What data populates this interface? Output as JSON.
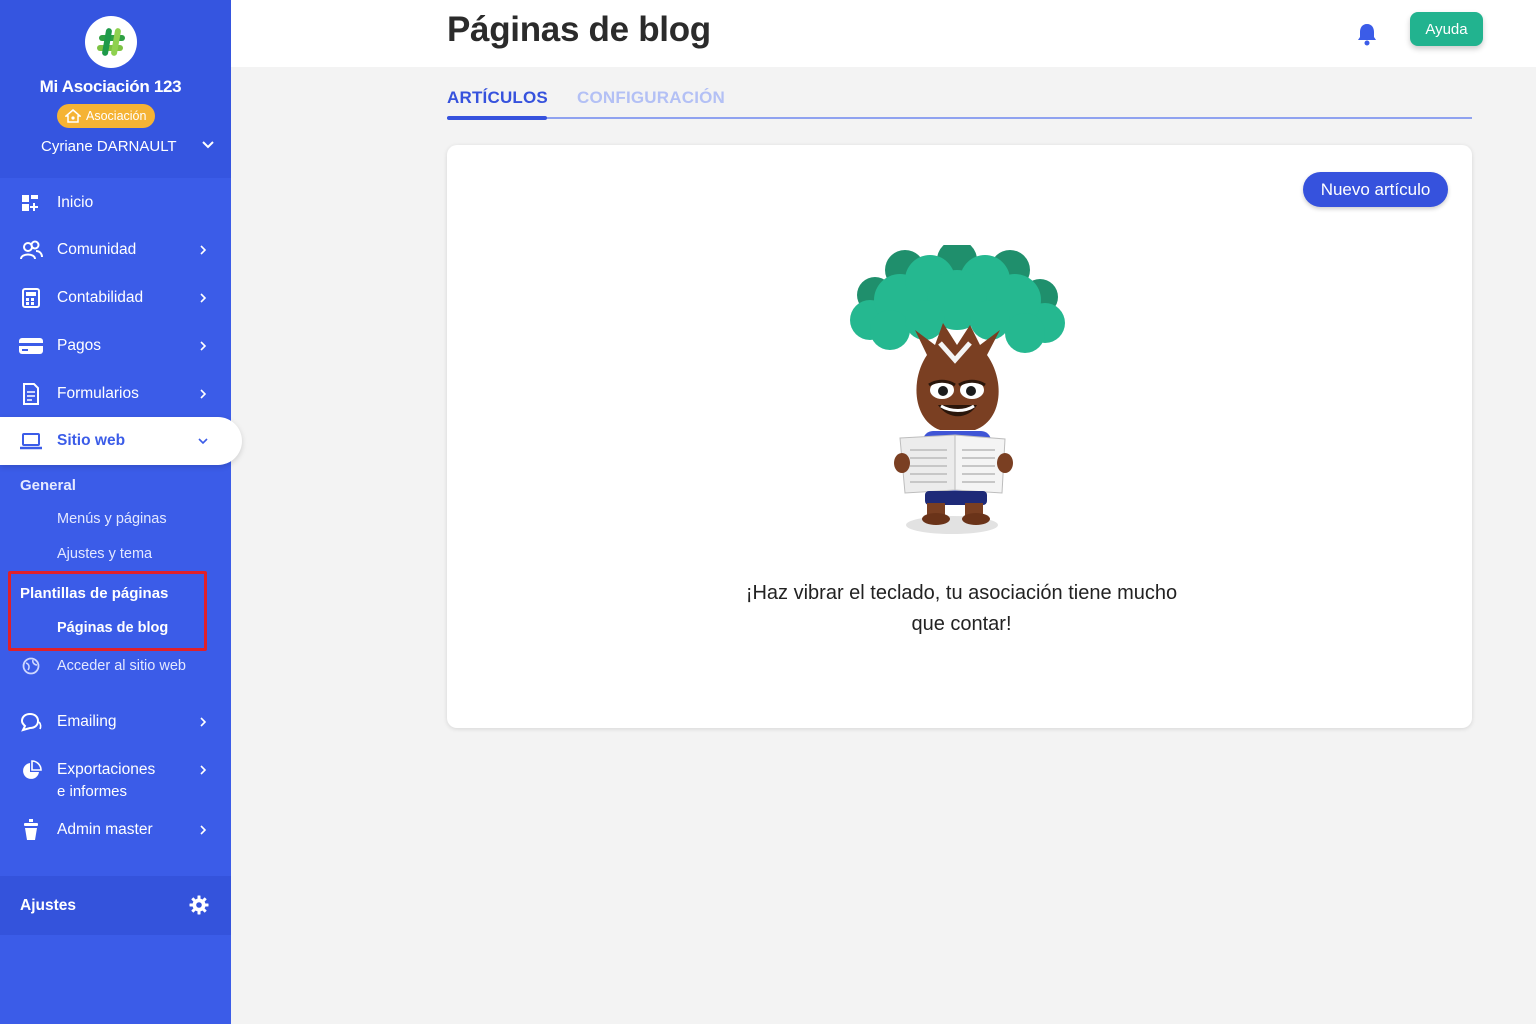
{
  "sidebar": {
    "org_name": "Mi Asociación 123",
    "org_badge": "Asociación",
    "user_name": "Cyriane DARNAULT",
    "items": [
      {
        "label": "Inicio",
        "icon": "dashboard-icon"
      },
      {
        "label": "Comunidad",
        "icon": "community-icon"
      },
      {
        "label": "Contabilidad",
        "icon": "calculator-icon"
      },
      {
        "label": "Pagos",
        "icon": "credit-card-icon"
      },
      {
        "label": "Formularios",
        "icon": "document-icon"
      },
      {
        "label": "Sitio web",
        "icon": "laptop-icon"
      },
      {
        "label": "Emailing",
        "icon": "chat-icon"
      },
      {
        "label": "Exportaciones",
        "label2": "e informes",
        "icon": "pie-chart-icon"
      },
      {
        "label": "Admin master",
        "icon": "cup-icon"
      }
    ],
    "website_sub": {
      "general_title": "General",
      "menus_pages": "Menús y páginas",
      "settings_theme": "Ajustes y tema",
      "templates_title": "Plantillas de páginas",
      "blog_pages": "Páginas de blog",
      "visit_site": "Acceder al sitio web"
    },
    "settings_label": "Ajustes"
  },
  "header": {
    "title": "Páginas de blog",
    "help_label": "Ayuda"
  },
  "tabs": [
    {
      "label": "ARTÍCULOS",
      "active": true
    },
    {
      "label": "CONFIGURACIÓN",
      "active": false
    }
  ],
  "main": {
    "new_article_label": "Nuevo artículo",
    "empty_line1": "¡Haz vibrar el teclado, tu asociación tiene mucho",
    "empty_line2": "que contar!"
  },
  "colors": {
    "sidebar": "#3b5ce8",
    "accent": "#3652dd",
    "help": "#22b38f",
    "badge": "#f5b335",
    "highlight": "#e0202a"
  }
}
